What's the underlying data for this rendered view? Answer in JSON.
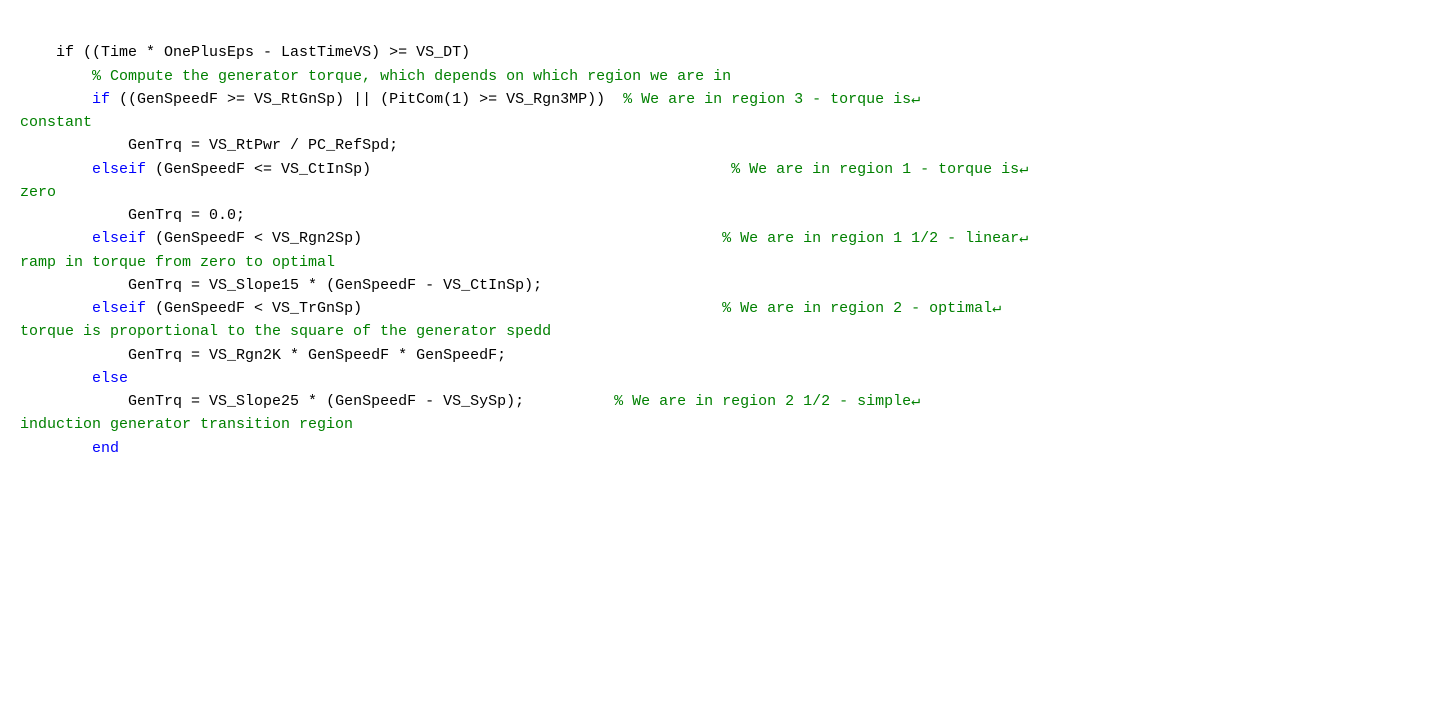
{
  "code": {
    "lines": [
      {
        "id": "line1",
        "type": "code",
        "indent": 4,
        "content": [
          {
            "t": "code",
            "v": "if ((Time * OnePlusEps - LastTimeVS) >= VS_DT)"
          }
        ]
      },
      {
        "id": "line2",
        "type": "code",
        "indent": 8,
        "content": [
          {
            "t": "comment",
            "v": "% Compute the generator torque, which depends on which region we are in"
          }
        ]
      },
      {
        "id": "line3",
        "type": "mixed",
        "indent": 8,
        "content": [
          {
            "t": "kw",
            "v": "if"
          },
          {
            "t": "code",
            "v": " ((GenSpeedF >= VS_RtGnSp) || (PitCom(1) >= VS_Rgn3MP))"
          },
          {
            "t": "comment",
            "v": "  % We are in region 3 - torque is↵"
          }
        ]
      },
      {
        "id": "line3b",
        "type": "wrap-comment",
        "indent": 0,
        "content": [
          {
            "t": "wrap-comment",
            "v": "constant"
          }
        ]
      },
      {
        "id": "line4",
        "type": "code",
        "indent": 12,
        "content": [
          {
            "t": "code",
            "v": "GenTrq = VS_RtPwr / PC_RefSpd;"
          }
        ]
      },
      {
        "id": "line5",
        "type": "mixed",
        "indent": 8,
        "content": [
          {
            "t": "kw",
            "v": "elseif"
          },
          {
            "t": "code",
            "v": " (GenSpeedF <= VS_CtInSp)"
          },
          {
            "t": "comment",
            "v": "                                        % We are in region 1 - torque is↵"
          }
        ]
      },
      {
        "id": "line5b",
        "type": "wrap-comment",
        "indent": 0,
        "content": [
          {
            "t": "wrap-comment",
            "v": "zero"
          }
        ]
      },
      {
        "id": "line6",
        "type": "code",
        "indent": 12,
        "content": [
          {
            "t": "code",
            "v": "GenTrq = 0.0;"
          }
        ]
      },
      {
        "id": "line7",
        "type": "mixed",
        "indent": 8,
        "content": [
          {
            "t": "kw",
            "v": "elseif"
          },
          {
            "t": "code",
            "v": " (GenSpeedF < VS_Rgn2Sp)"
          },
          {
            "t": "comment",
            "v": "                                        % We are in region 1 1/2 - linear↵"
          }
        ]
      },
      {
        "id": "line7b",
        "type": "wrap-comment",
        "indent": 0,
        "content": [
          {
            "t": "wrap-comment",
            "v": "ramp in torque from zero to optimal"
          }
        ]
      },
      {
        "id": "line8",
        "type": "code",
        "indent": 12,
        "content": [
          {
            "t": "code",
            "v": "GenTrq = VS_Slope15 * (GenSpeedF - VS_CtInSp);"
          }
        ]
      },
      {
        "id": "line9",
        "type": "mixed",
        "indent": 8,
        "content": [
          {
            "t": "kw",
            "v": "elseif"
          },
          {
            "t": "code",
            "v": " (GenSpeedF < VS_TrGnSp)"
          },
          {
            "t": "comment",
            "v": "                                        % We are in region 2 - optimal↵"
          }
        ]
      },
      {
        "id": "line9b",
        "type": "wrap-comment",
        "indent": 0,
        "content": [
          {
            "t": "wrap-comment",
            "v": "torque is proportional to the square of the generator spedd"
          }
        ]
      },
      {
        "id": "line10",
        "type": "code",
        "indent": 12,
        "content": [
          {
            "t": "code",
            "v": "GenTrq = VS_Rgn2K * GenSpeedF * GenSpeedF;"
          }
        ]
      },
      {
        "id": "line11",
        "type": "code",
        "indent": 8,
        "content": [
          {
            "t": "kw",
            "v": "else"
          }
        ]
      },
      {
        "id": "line12",
        "type": "mixed",
        "indent": 12,
        "content": [
          {
            "t": "code",
            "v": "GenTrq = VS_Slope25 * (GenSpeedF - VS_SySp);"
          },
          {
            "t": "comment",
            "v": "          % We are in region 2 1/2 - simple↵"
          }
        ]
      },
      {
        "id": "line12b",
        "type": "wrap-comment",
        "indent": 0,
        "content": [
          {
            "t": "wrap-comment",
            "v": "induction generator transition region"
          }
        ]
      },
      {
        "id": "line13",
        "type": "code",
        "indent": 8,
        "content": [
          {
            "t": "kw",
            "v": "end"
          }
        ]
      }
    ]
  }
}
